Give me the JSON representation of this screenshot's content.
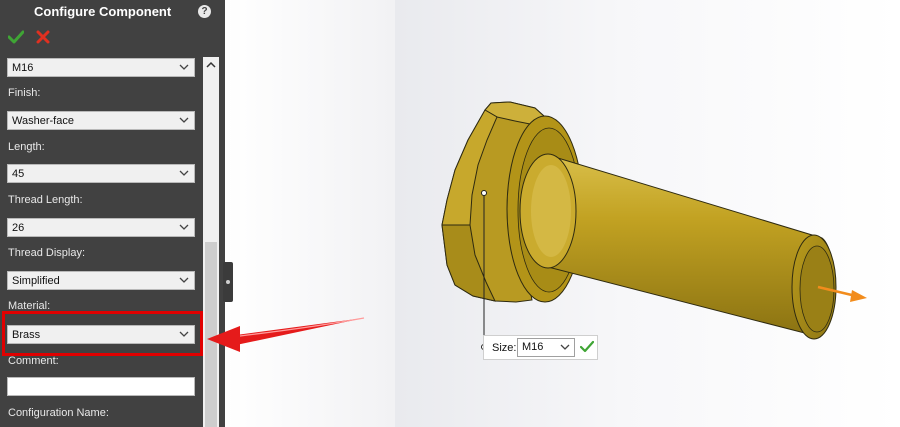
{
  "panel": {
    "title": "Configure Component",
    "help_glyph": "?",
    "fields": [
      {
        "label": "",
        "value": "M16"
      },
      {
        "label": "Finish:",
        "value": "Washer-face"
      },
      {
        "label": "Length:",
        "value": "45"
      },
      {
        "label": "Thread Length:",
        "value": "26"
      },
      {
        "label": "Thread Display:",
        "value": "Simplified"
      },
      {
        "label": "Material:",
        "value": "Brass"
      },
      {
        "label": "Comment:",
        "value": ""
      },
      {
        "label": "Configuration Name:",
        "value": ""
      }
    ],
    "icons": {
      "ok": "checkmark-icon",
      "cancel": "x-icon",
      "help": "help-icon",
      "dropdown": "chevron-down-icon"
    }
  },
  "callout": {
    "label": "Size:",
    "value": "M16"
  },
  "colors": {
    "panel_bg": "#414141",
    "accent_ok": "#3fa535",
    "accent_cancel": "#e03020",
    "highlight": "#e00000",
    "bolt": "#b99a20",
    "direction_arrow": "#f28c1c"
  }
}
